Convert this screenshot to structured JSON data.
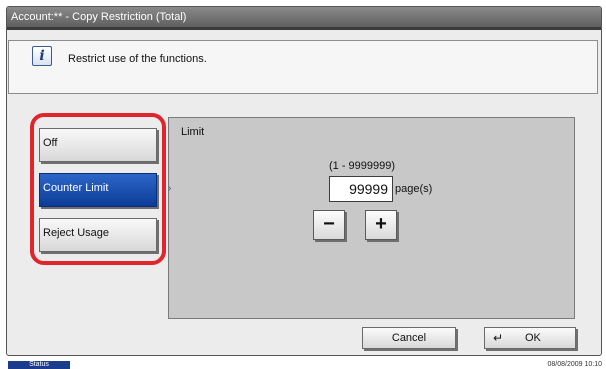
{
  "window": {
    "title": "Account:** - Copy Restriction (Total)"
  },
  "message": {
    "icon": "info-icon",
    "text": "Restrict use of the functions."
  },
  "options": [
    {
      "label": "Off",
      "selected": false
    },
    {
      "label": "Counter Limit",
      "selected": true
    },
    {
      "label": "Reject Usage",
      "selected": false
    }
  ],
  "limit": {
    "title": "Limit",
    "range": "(1 - 9999999)",
    "value": "99999",
    "unit": "page(s)",
    "minus_symbol": "−",
    "plus_symbol": "+"
  },
  "footer": {
    "cancel_label": "Cancel",
    "ok_label": "OK",
    "ok_icon": "↵"
  },
  "statusbar": {
    "status_label": "Status",
    "datetime": "08/08/2009   10:10"
  },
  "colors": {
    "selected_option": "#1a4fb0",
    "highlight_ring": "#e0252c",
    "title_bar": "#6e6e6e",
    "status_label": "#1b3c8c"
  }
}
